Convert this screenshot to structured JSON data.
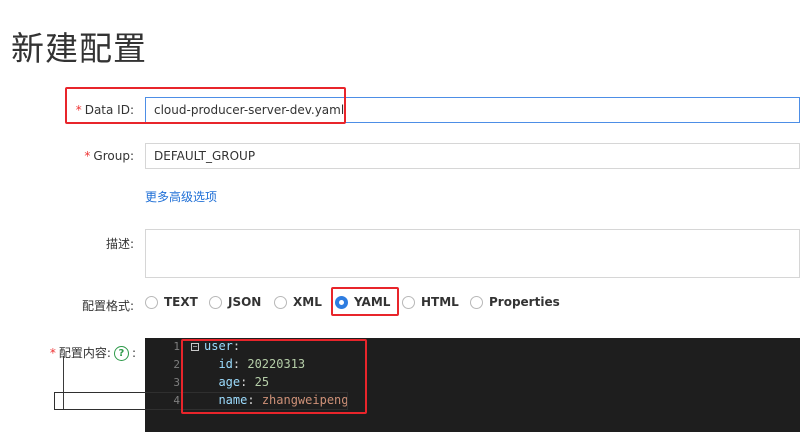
{
  "page": {
    "title": "新建配置"
  },
  "form": {
    "data_id": {
      "required": "*",
      "label": "Data ID:",
      "value": "cloud-producer-server-dev.yaml"
    },
    "group": {
      "required": "*",
      "label": "Group:",
      "value": "DEFAULT_GROUP"
    },
    "advanced_link": "更多高级选项",
    "description": {
      "label": "描述:",
      "value": ""
    },
    "format": {
      "label": "配置格式:",
      "options": [
        "TEXT",
        "JSON",
        "XML",
        "YAML",
        "HTML",
        "Properties"
      ],
      "selected": "YAML"
    },
    "content": {
      "required": "*",
      "label": "配置内容:",
      "help_icon": "question-circle-icon",
      "help_glyph": "?",
      "colon": ":"
    }
  },
  "editor": {
    "line_numbers": [
      "1",
      "2",
      "3",
      "4"
    ],
    "fold_glyph": "−",
    "lines": [
      {
        "indent": "",
        "key": "user",
        "sep": ":",
        "value": ""
      },
      {
        "indent": "  ",
        "key": "id",
        "sep": ": ",
        "value": "20220313"
      },
      {
        "indent": "  ",
        "key": "age",
        "sep": ": ",
        "value": "25"
      },
      {
        "indent": "  ",
        "key": "name",
        "sep": ": ",
        "value": "zhangweipeng"
      }
    ]
  },
  "colors": {
    "accent": "#2f7de0",
    "highlight_box": "#e8252b",
    "required": "#ee3333",
    "editor_bg": "#1e1e1e"
  }
}
